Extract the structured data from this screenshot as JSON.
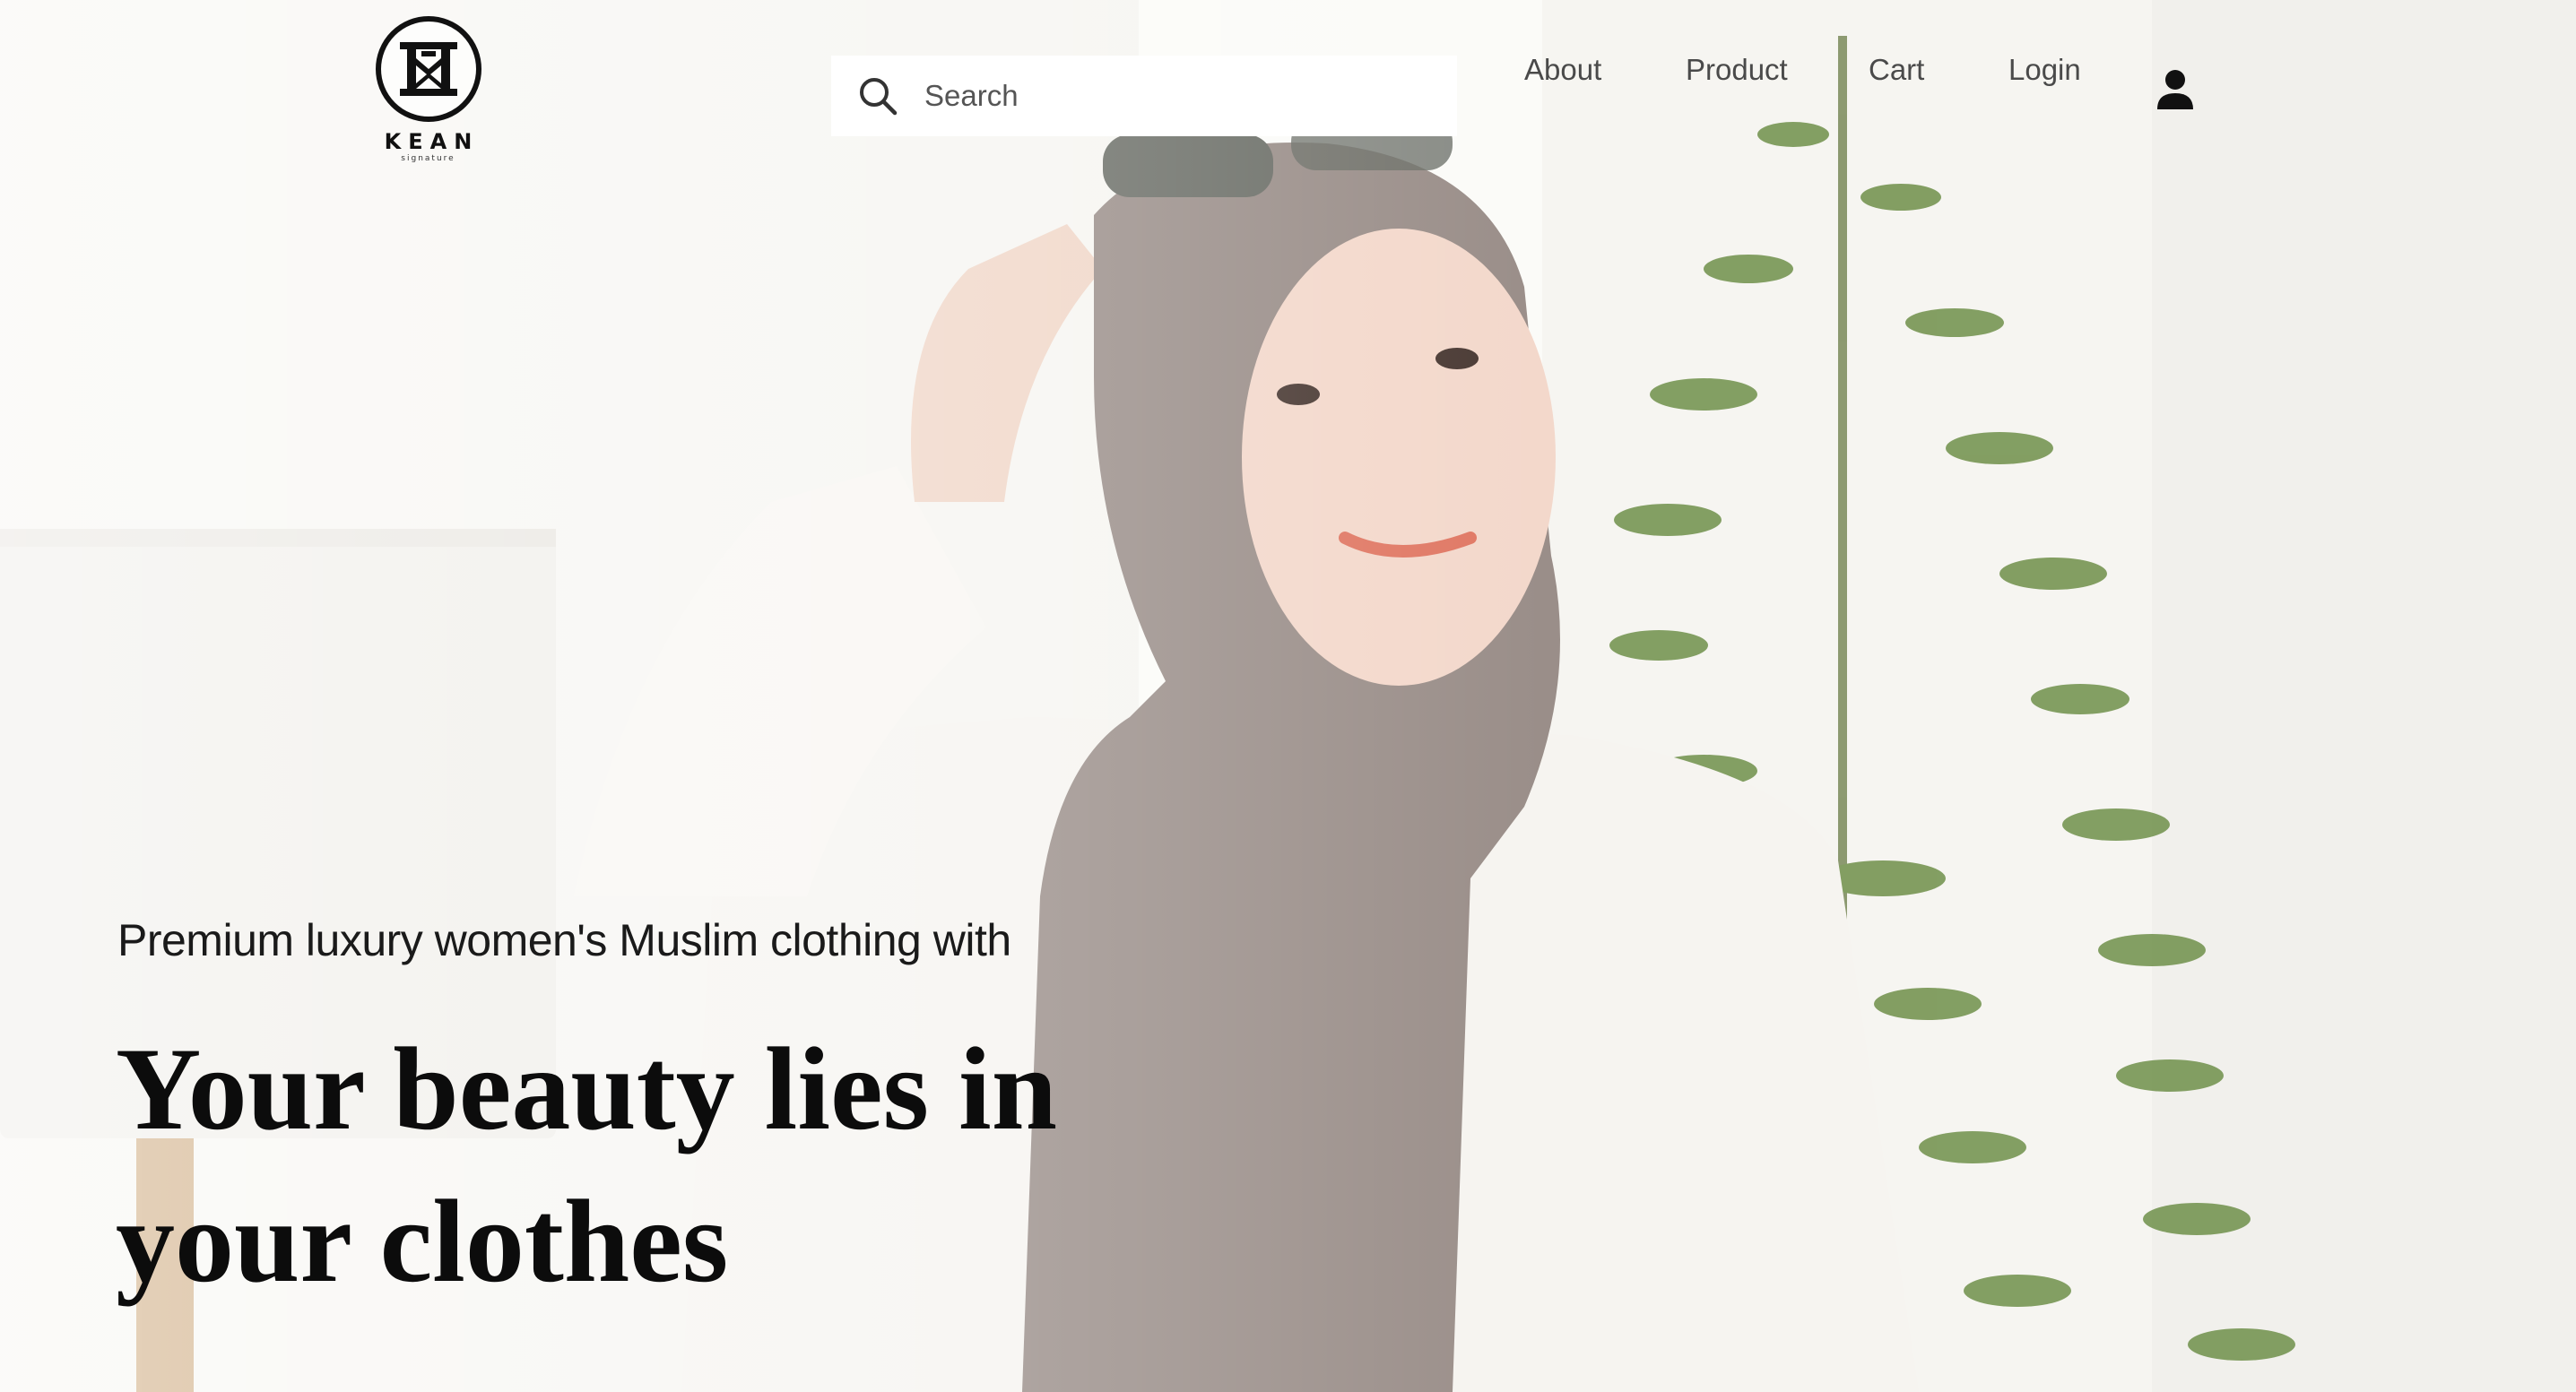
{
  "brand": {
    "name": "KEAN",
    "subtitle": "signature"
  },
  "search": {
    "placeholder": "Search",
    "value": ""
  },
  "nav": {
    "items": [
      {
        "label": "About"
      },
      {
        "label": "Product"
      },
      {
        "label": "Cart"
      },
      {
        "label": "Login"
      }
    ]
  },
  "hero": {
    "tagline": "Premium luxury women's Muslim clothing with",
    "headline_line1": "Your beauty lies in",
    "headline_line2": "your clothes"
  },
  "icons": {
    "search": "search-icon",
    "user": "user-icon"
  },
  "colors": {
    "text_dark": "#0c0c0c",
    "nav_text": "#4a4a4a",
    "search_bg": "#ffffff",
    "hijab": "#9a8e89",
    "shirt": "#f6f4f0",
    "plant": "#6f8f4a"
  }
}
